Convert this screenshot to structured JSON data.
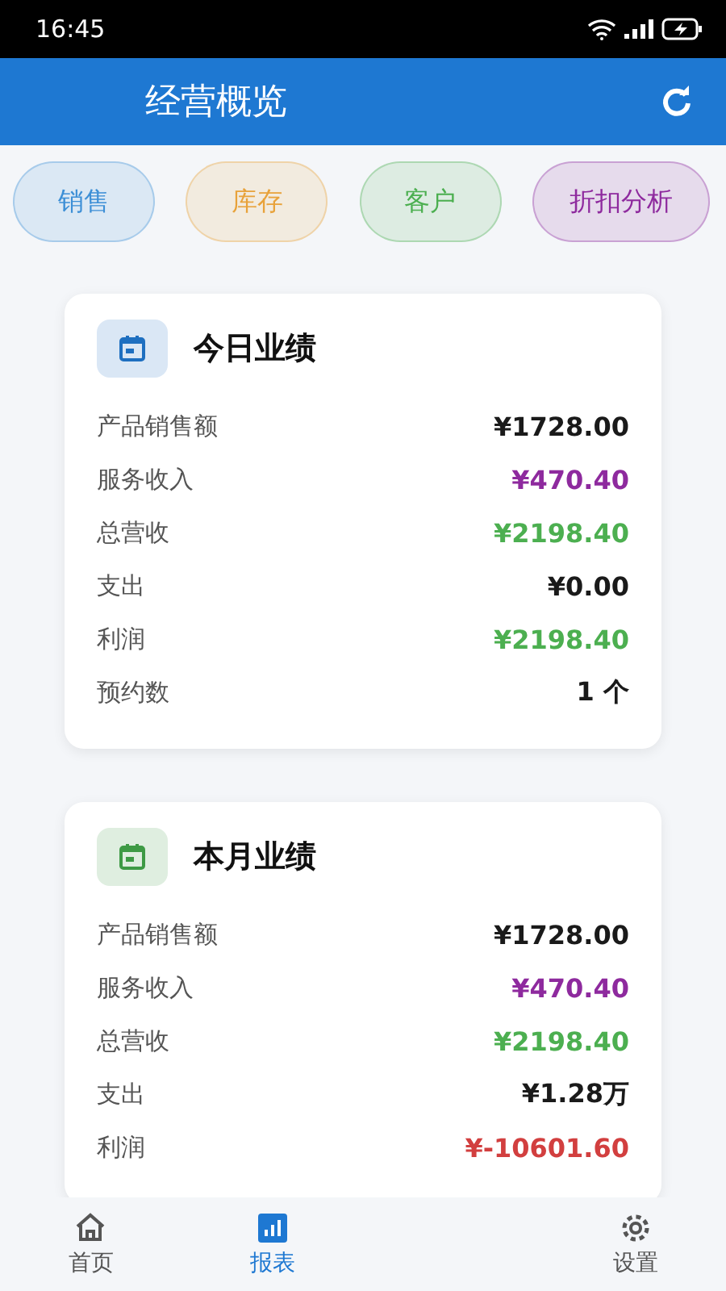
{
  "status_bar": {
    "time": "16:45"
  },
  "header": {
    "title": "经营概览"
  },
  "chips": [
    {
      "label": "销售",
      "color": "#3d8fd6"
    },
    {
      "label": "库存",
      "color": "#e8a23a"
    },
    {
      "label": "客户",
      "color": "#4caf50"
    },
    {
      "label": "折扣分析",
      "color": "#8e2a9e"
    }
  ],
  "cards": [
    {
      "title": "今日业绩",
      "color": "#1e6fc0",
      "rows": [
        {
          "label": "产品销售额",
          "value": "¥1728.00",
          "color": "#1a1a1a"
        },
        {
          "label": "服务收入",
          "value": "¥470.40",
          "color": "#8e2a9e"
        },
        {
          "label": "总营收",
          "value": "¥2198.40",
          "color": "#4caf50"
        },
        {
          "label": "支出",
          "value": "¥0.00",
          "color": "#1a1a1a"
        },
        {
          "label": "利润",
          "value": "¥2198.40",
          "color": "#4caf50"
        },
        {
          "label": "预约数",
          "value": "1 个",
          "color": "#1a1a1a"
        }
      ]
    },
    {
      "title": "本月业绩",
      "color": "#3e9a45",
      "rows": [
        {
          "label": "产品销售额",
          "value": "¥1728.00",
          "color": "#1a1a1a"
        },
        {
          "label": "服务收入",
          "value": "¥470.40",
          "color": "#8e2a9e"
        },
        {
          "label": "总营收",
          "value": "¥2198.40",
          "color": "#4caf50"
        },
        {
          "label": "支出",
          "value": "¥1.28万",
          "color": "#1a1a1a"
        },
        {
          "label": "利润",
          "value": "¥-10601.60",
          "color": "#d23f3f"
        }
      ]
    }
  ],
  "bottom_nav": [
    {
      "label": "首页",
      "kind": "home",
      "selected": false
    },
    {
      "label": "报表",
      "kind": "chart",
      "selected": true
    },
    {
      "label": "设置",
      "kind": "gear",
      "selected": false
    }
  ]
}
